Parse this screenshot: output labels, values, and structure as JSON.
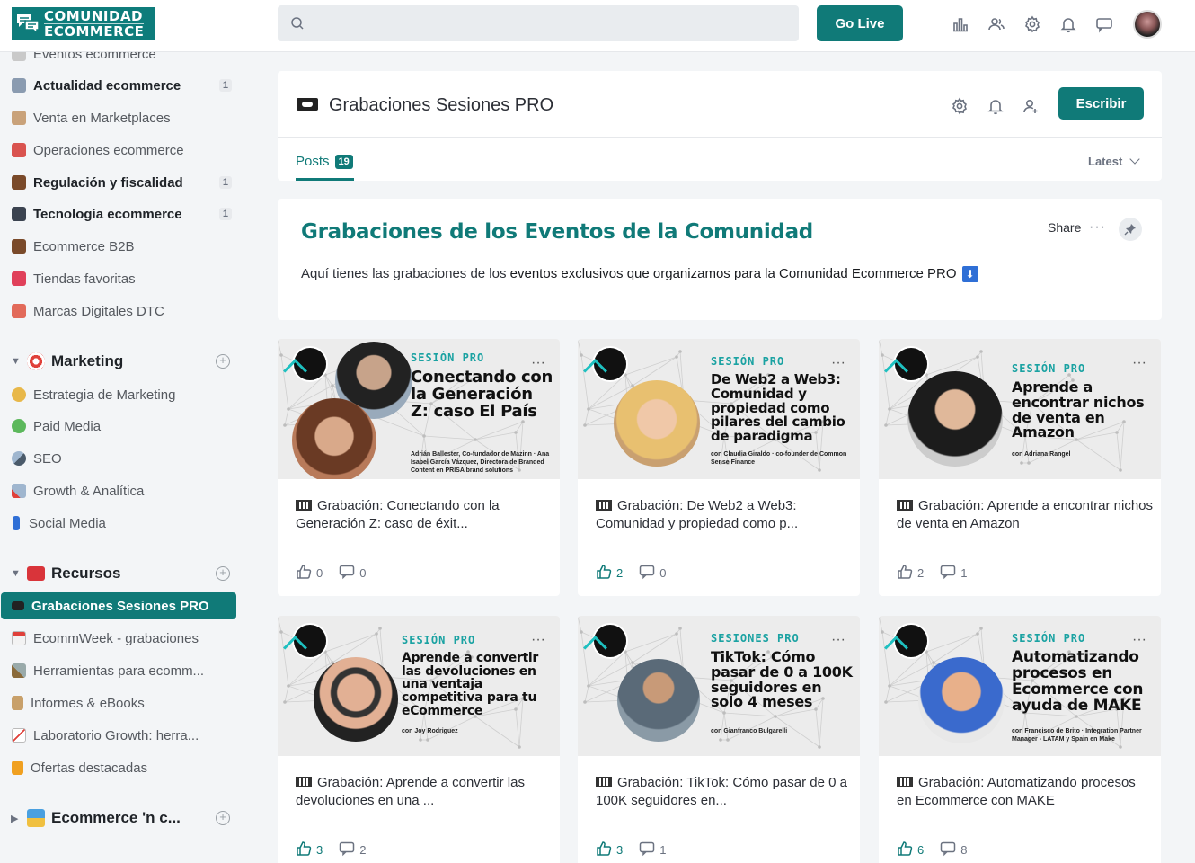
{
  "brand": {
    "line1": "COMUNIDAD",
    "line2": "ECOMMERCE"
  },
  "topbar": {
    "search_placeholder": "",
    "golive_label": "Go Live"
  },
  "sidebar": {
    "partial_item": "Eventos ecommerce",
    "items": [
      {
        "label": "Actualidad ecommerce",
        "count": "1",
        "bold": true
      },
      {
        "label": "Venta en Marketplaces"
      },
      {
        "label": "Operaciones ecommerce"
      },
      {
        "label": "Regulación y fiscalidad",
        "count": "1",
        "bold": true
      },
      {
        "label": "Tecnología ecommerce",
        "count": "1",
        "bold": true
      },
      {
        "label": "Ecommerce B2B"
      },
      {
        "label": "Tiendas favoritas"
      },
      {
        "label": "Marcas Digitales DTC"
      }
    ],
    "group_marketing": "Marketing",
    "marketing_items": [
      "Estrategia de Marketing",
      "Paid Media",
      "SEO",
      "Growth & Analítica",
      "Social Media"
    ],
    "group_recursos": "Recursos",
    "recursos_items": [
      "Grabaciones Sesiones PRO",
      "EcommWeek - grabaciones",
      "Herramientas para ecomm...",
      "Informes & eBooks",
      "Laboratorio Growth: herra...",
      "Ofertas destacadas"
    ],
    "group_ecommerce": "Ecommerce 'n c..."
  },
  "space": {
    "title": "Grabaciones Sesiones PRO",
    "write_label": "Escribir",
    "tab_posts": "Posts",
    "posts_count": "19",
    "sort_label": "Latest"
  },
  "intro": {
    "title": "Grabaciones de los Eventos de la Comunidad",
    "text_pre": "Aquí tienes las grabaciones de los ",
    "text_bold": "eventos exclusivos que organizamos para la Comunidad Ecommerce PRO",
    "arrow": "⬇",
    "share_label": "Share",
    "more": "···"
  },
  "cards": [
    {
      "tag": "SESIÓN PRO",
      "headline": "Conectando con la Generación Z: caso El País",
      "sub": "Adrián Ballester, Co-fundador de Mazinn · Ana Isabel García Vázquez, Directora de Branded Content en PRISA brand solutions",
      "title": "Grabación: Conectando con la Generación Z: caso de éxit...",
      "likes": "0",
      "comments": "0",
      "liked": false
    },
    {
      "tag": "SESIÓN PRO",
      "headline": "De Web2 a Web3: Comunidad y propiedad como pilares del cambio de paradigma",
      "sub": "con Claudia Giraldo · co-founder de Common Sense Finance",
      "title": "Grabación: De Web2 a Web3: Comunidad y propiedad como p...",
      "likes": "2",
      "comments": "0",
      "liked": true
    },
    {
      "tag": "SESIÓN PRO",
      "headline": "Aprende a encontrar nichos de venta en Amazon",
      "sub": "con Adriana Rangel",
      "title": "Grabación: Aprende a encontrar nichos de venta en Amazon",
      "likes": "2",
      "comments": "1",
      "liked": false
    },
    {
      "tag": "SESIÓN PRO",
      "headline": "Aprende a convertir las devoluciones en una ventaja competitiva para tu eCommerce",
      "sub": "con Joy Rodriguez",
      "title": "Grabación: Aprende a convertir las devoluciones en una ...",
      "likes": "3",
      "comments": "2",
      "liked": true
    },
    {
      "tag": "SESIONES PRO",
      "headline": "TikTok: Cómo pasar de 0 a 100K seguidores en solo 4 meses",
      "sub": "con Gianfranco Bulgarelli",
      "title": "Grabación: TikTok: Cómo pasar de 0 a 100K seguidores en...",
      "likes": "3",
      "comments": "1",
      "liked": true
    },
    {
      "tag": "SESIÓN PRO",
      "headline": "Automatizando procesos en Ecommerce con ayuda de MAKE",
      "sub": "con Francisco de Brito · Integration Partner Manager - LATAM y Spain en Make",
      "title": "Grabación: Automatizando procesos en Ecommerce con MAKE",
      "likes": "6",
      "comments": "8",
      "liked": true
    }
  ],
  "colors": {
    "accent": "#107a78",
    "bg": "#f3f5f7",
    "teal_tag": "#1aa2a2"
  },
  "icons": [
    "search-icon",
    "chart-icon",
    "users-icon",
    "gear-icon",
    "bell-icon",
    "chat-icon",
    "like-icon",
    "comment-icon",
    "pin-icon",
    "add-member-icon",
    "tape-icon"
  ]
}
